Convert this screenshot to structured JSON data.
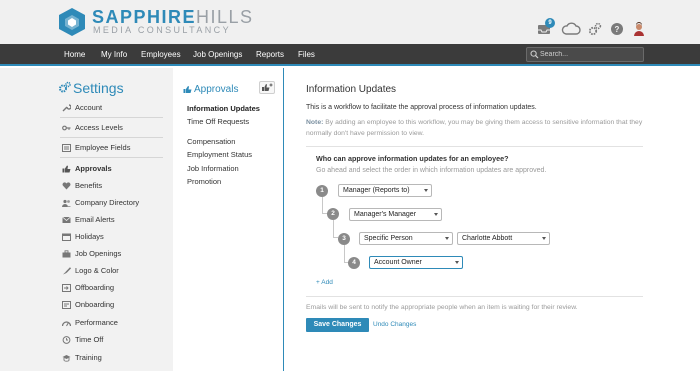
{
  "brand": {
    "name_bold": "SAPPHIRE",
    "name_light": "HILLS",
    "subtitle": "MEDIA CONSULTANCY",
    "accent": "#2e8ab8"
  },
  "top_icons": {
    "inbox_badge": "9",
    "icons": [
      "inbox-icon",
      "cloud-upload-icon",
      "settings-gears-icon",
      "help-icon",
      "user-avatar-icon"
    ]
  },
  "nav": {
    "items": [
      "Home",
      "My Info",
      "Employees",
      "Job Openings",
      "Reports",
      "Files"
    ],
    "search_placeholder": "Search..."
  },
  "settings": {
    "title": "Settings",
    "items": [
      {
        "label": "Account",
        "icon": "wrench-icon"
      },
      {
        "label": "Access Levels",
        "icon": "key-icon"
      },
      {
        "label": "Employee Fields",
        "icon": "list-icon"
      },
      {
        "label": "Approvals",
        "icon": "thumbs-up-icon",
        "active": true
      },
      {
        "label": "Benefits",
        "icon": "heart-icon"
      },
      {
        "label": "Company Directory",
        "icon": "people-icon"
      },
      {
        "label": "Email Alerts",
        "icon": "envelope-icon"
      },
      {
        "label": "Holidays",
        "icon": "calendar-icon"
      },
      {
        "label": "Job Openings",
        "icon": "briefcase-icon"
      },
      {
        "label": "Logo & Color",
        "icon": "paint-icon"
      },
      {
        "label": "Offboarding",
        "icon": "offboarding-icon"
      },
      {
        "label": "Onboarding",
        "icon": "onboarding-icon"
      },
      {
        "label": "Performance",
        "icon": "gauge-icon"
      },
      {
        "label": "Time Off",
        "icon": "clock-icon"
      },
      {
        "label": "Training",
        "icon": "training-icon"
      }
    ]
  },
  "approvals_nav": {
    "title": "Approvals",
    "links": [
      "Information Updates",
      "Time Off Requests",
      "Compensation",
      "Employment Status",
      "Job Information",
      "Promotion"
    ]
  },
  "main": {
    "title": "Information Updates",
    "description": "This is a workflow to facilitate the approval process of information updates.",
    "note_label": "Note:",
    "note_text": " By adding an employee to this workflow, you may be giving them access to sensitive information that they normally don't have permission to view.",
    "question": "Who can approve information updates for an employee?",
    "question_sub": "Go ahead and select the order in which information updates are approved.",
    "steps": [
      {
        "num": "1",
        "value": "Manager (Reports to)"
      },
      {
        "num": "2",
        "value": "Manager's Manager"
      },
      {
        "num": "3",
        "value": "Specific Person",
        "person": "Charlotte Abbott"
      },
      {
        "num": "4",
        "value": "Account Owner"
      }
    ],
    "add_label": "+ Add",
    "footer_note": "Emails will be sent to notify the appropriate people when an item is waiting for their review.",
    "save_label": "Save Changes",
    "undo_label": "Undo Changes"
  }
}
